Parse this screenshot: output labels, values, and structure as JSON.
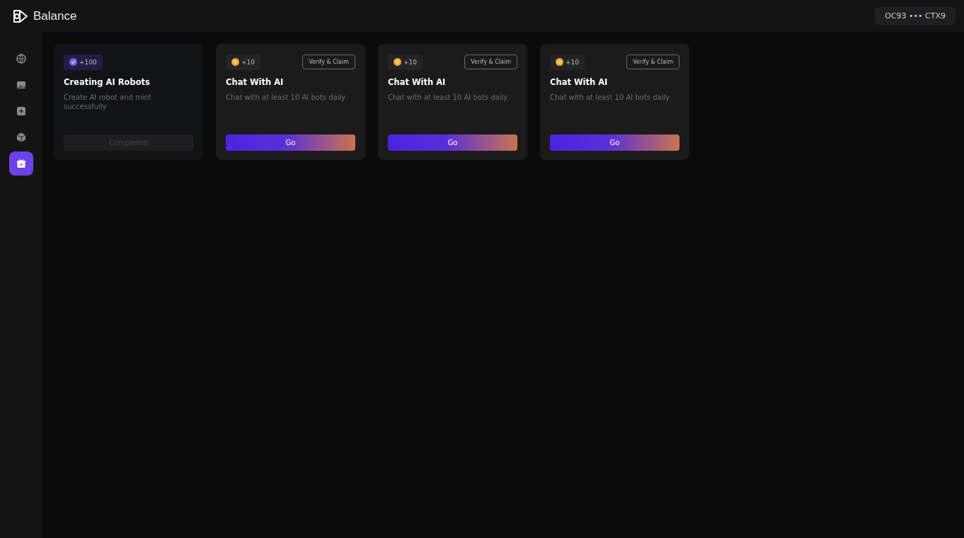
{
  "header": {
    "brand": "Balance",
    "wallet": "OC93 ••• CTX9"
  },
  "sidebar": {
    "items": [
      {
        "kind": "globe",
        "selected": false
      },
      {
        "kind": "image",
        "selected": false
      },
      {
        "kind": "plus",
        "selected": false
      },
      {
        "kind": "cube",
        "selected": false
      },
      {
        "kind": "gift",
        "selected": true
      }
    ]
  },
  "tasks": [
    {
      "kind": "completed",
      "reward": "+100",
      "title": "Creating AI Robots",
      "description": "Create AI robot and mint successfully",
      "action": "Completed"
    },
    {
      "kind": "open",
      "reward": "+10",
      "claim": "Verify & Claim",
      "title": "Chat With AI",
      "description": "Chat with at least 10 AI bots daily",
      "action": "Go"
    },
    {
      "kind": "open",
      "reward": "+10",
      "claim": "Verify & Claim",
      "title": "Chat With AI",
      "description": "Chat with at least 10 AI bots daily",
      "action": "Go"
    },
    {
      "kind": "open",
      "reward": "+10",
      "claim": "Verify & Claim",
      "title": "Chat With AI",
      "description": "Chat with at least 10 AI bots daily",
      "action": "Go"
    }
  ]
}
